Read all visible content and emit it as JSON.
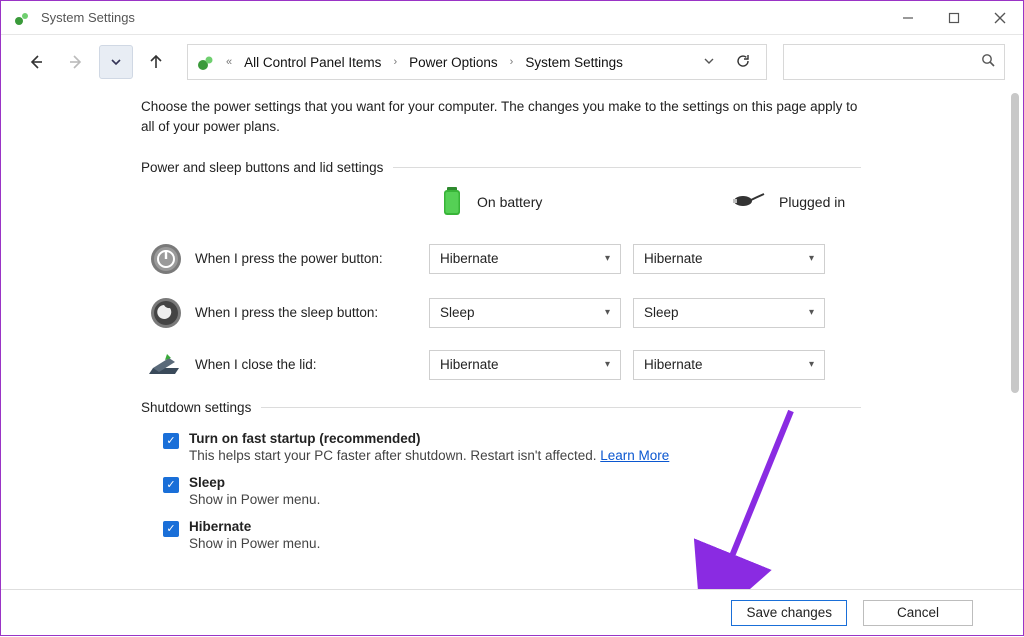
{
  "window": {
    "title": "System Settings"
  },
  "breadcrumb": {
    "item1": "All Control Panel Items",
    "item2": "Power Options",
    "item3": "System Settings"
  },
  "intro": "Choose the power settings that you want for your computer. The changes you make to the settings on this page apply to all of your power plans.",
  "section1": {
    "title": "Power and sleep buttons and lid settings"
  },
  "cols": {
    "battery": "On battery",
    "plugged": "Plugged in"
  },
  "rows": {
    "power": {
      "label": "When I press the power button:",
      "battery": "Hibernate",
      "plugged": "Hibernate"
    },
    "sleep": {
      "label": "When I press the sleep button:",
      "battery": "Sleep",
      "plugged": "Sleep"
    },
    "lid": {
      "label": "When I close the lid:",
      "battery": "Hibernate",
      "plugged": "Hibernate"
    }
  },
  "section2": {
    "title": "Shutdown settings"
  },
  "shutdown": {
    "fast": {
      "title": "Turn on fast startup (recommended)",
      "desc": "This helps start your PC faster after shutdown. Restart isn't affected. ",
      "link": "Learn More"
    },
    "sleep": {
      "title": "Sleep",
      "desc": "Show in Power menu."
    },
    "hibernate": {
      "title": "Hibernate",
      "desc": "Show in Power menu."
    }
  },
  "buttons": {
    "save": "Save changes",
    "cancel": "Cancel"
  }
}
